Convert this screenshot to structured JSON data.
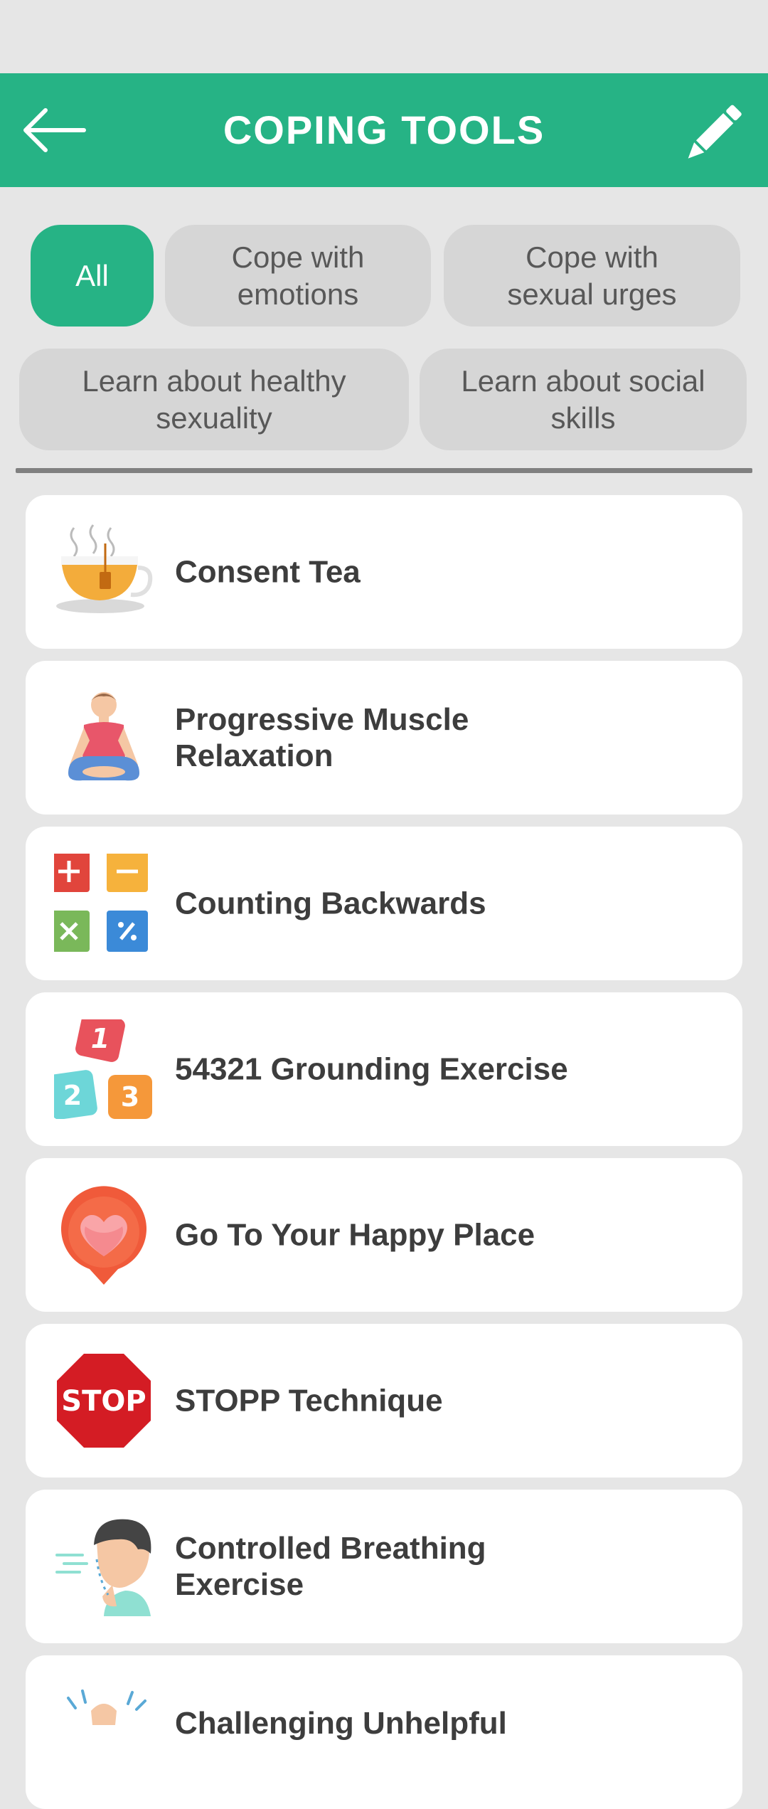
{
  "header": {
    "title": "COPING TOOLS"
  },
  "filters": [
    {
      "label": "All",
      "active": true
    },
    {
      "label": "Cope with emotions",
      "active": false
    },
    {
      "label": "Cope with sexual urges",
      "active": false
    },
    {
      "label": "Learn about healthy sexuality",
      "active": false
    },
    {
      "label": "Learn about social skills",
      "active": false
    }
  ],
  "tools": [
    {
      "title": "Consent Tea",
      "icon": "tea-cup-icon"
    },
    {
      "title": "Progressive Muscle Relaxation",
      "icon": "meditation-person-icon"
    },
    {
      "title": "Counting Backwards",
      "icon": "math-operations-icon"
    },
    {
      "title": "54321 Grounding Exercise",
      "icon": "number-blocks-icon"
    },
    {
      "title": "Go To Your Happy Place",
      "icon": "heart-location-pin-icon"
    },
    {
      "title": "STOPP Technique",
      "icon": "stop-sign-icon",
      "icon_text": "STOP"
    },
    {
      "title": "Controlled Breathing Exercise",
      "icon": "breathing-person-icon"
    },
    {
      "title": "Challenging Unhelpful",
      "icon": "person-cheering-icon"
    }
  ],
  "colors": {
    "accent": "#26b385",
    "background": "#e6e6e6",
    "chip": "#d6d6d6"
  }
}
